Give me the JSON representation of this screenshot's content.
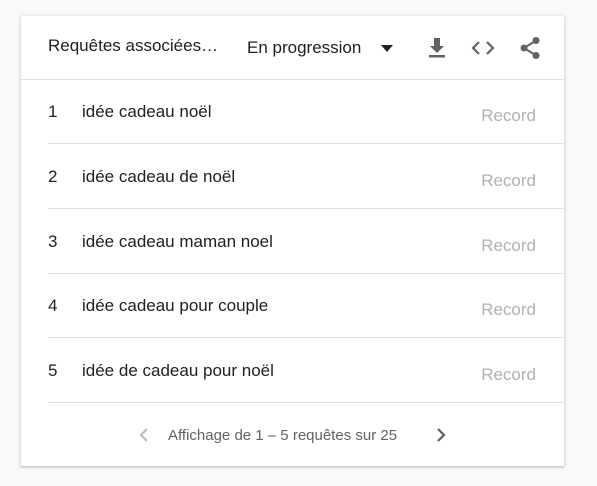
{
  "header": {
    "title": "Requêtes associées…",
    "dropdown_value": "En progression",
    "icons": [
      "download-icon",
      "embed-code-icon",
      "share-icon"
    ]
  },
  "rows": [
    {
      "rank": "1",
      "query": "idée cadeau noël",
      "value": "Record"
    },
    {
      "rank": "2",
      "query": "idée cadeau de noël",
      "value": "Record"
    },
    {
      "rank": "3",
      "query": "idée cadeau maman noel",
      "value": "Record"
    },
    {
      "rank": "4",
      "query": "idée cadeau pour couple",
      "value": "Record"
    },
    {
      "rank": "5",
      "query": "idée de cadeau pour noël",
      "value": "Record"
    }
  ],
  "pagination": {
    "text": "Affichage de 1 – 5 requêtes sur 25"
  },
  "colors": {
    "text": "#202124",
    "muted": "#b0b0b0",
    "divider": "#e0e0e0",
    "icon": "#5f6368"
  }
}
